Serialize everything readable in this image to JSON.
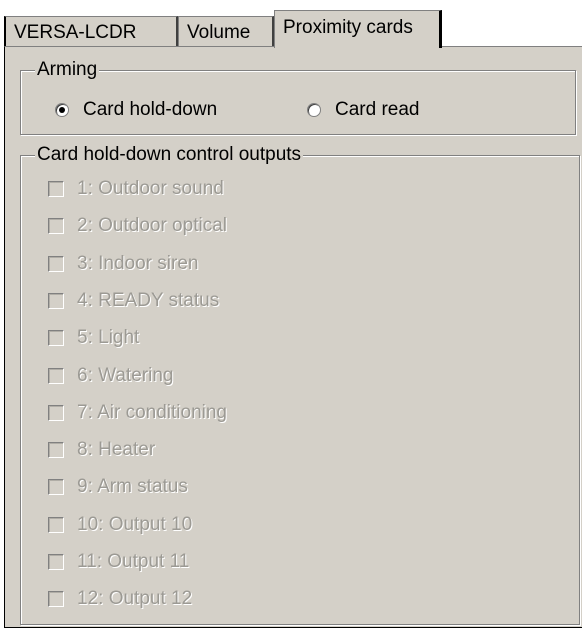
{
  "tabs": [
    {
      "label": "VERSA-LCDR"
    },
    {
      "label": "Volume"
    },
    {
      "label": "Proximity cards"
    }
  ],
  "active_tab": "Proximity cards",
  "arming": {
    "legend": "Arming",
    "options": [
      {
        "label": "Card hold-down",
        "checked": true
      },
      {
        "label": "Card read",
        "checked": false
      }
    ]
  },
  "outputs": {
    "legend": "Card hold-down control outputs",
    "disabled": true,
    "items": [
      {
        "label": "1: Outdoor sound",
        "checked": false
      },
      {
        "label": "2: Outdoor optical",
        "checked": false
      },
      {
        "label": "3: Indoor siren",
        "checked": false
      },
      {
        "label": "4: READY status",
        "checked": false
      },
      {
        "label": "5: Light",
        "checked": false
      },
      {
        "label": "6: Watering",
        "checked": false
      },
      {
        "label": "7: Air conditioning",
        "checked": false
      },
      {
        "label": "8: Heater",
        "checked": false
      },
      {
        "label": "9: Arm status",
        "checked": false
      },
      {
        "label": "10: Output 10",
        "checked": false
      },
      {
        "label": "11: Output 11",
        "checked": false
      },
      {
        "label": "12: Output 12",
        "checked": false
      }
    ]
  }
}
